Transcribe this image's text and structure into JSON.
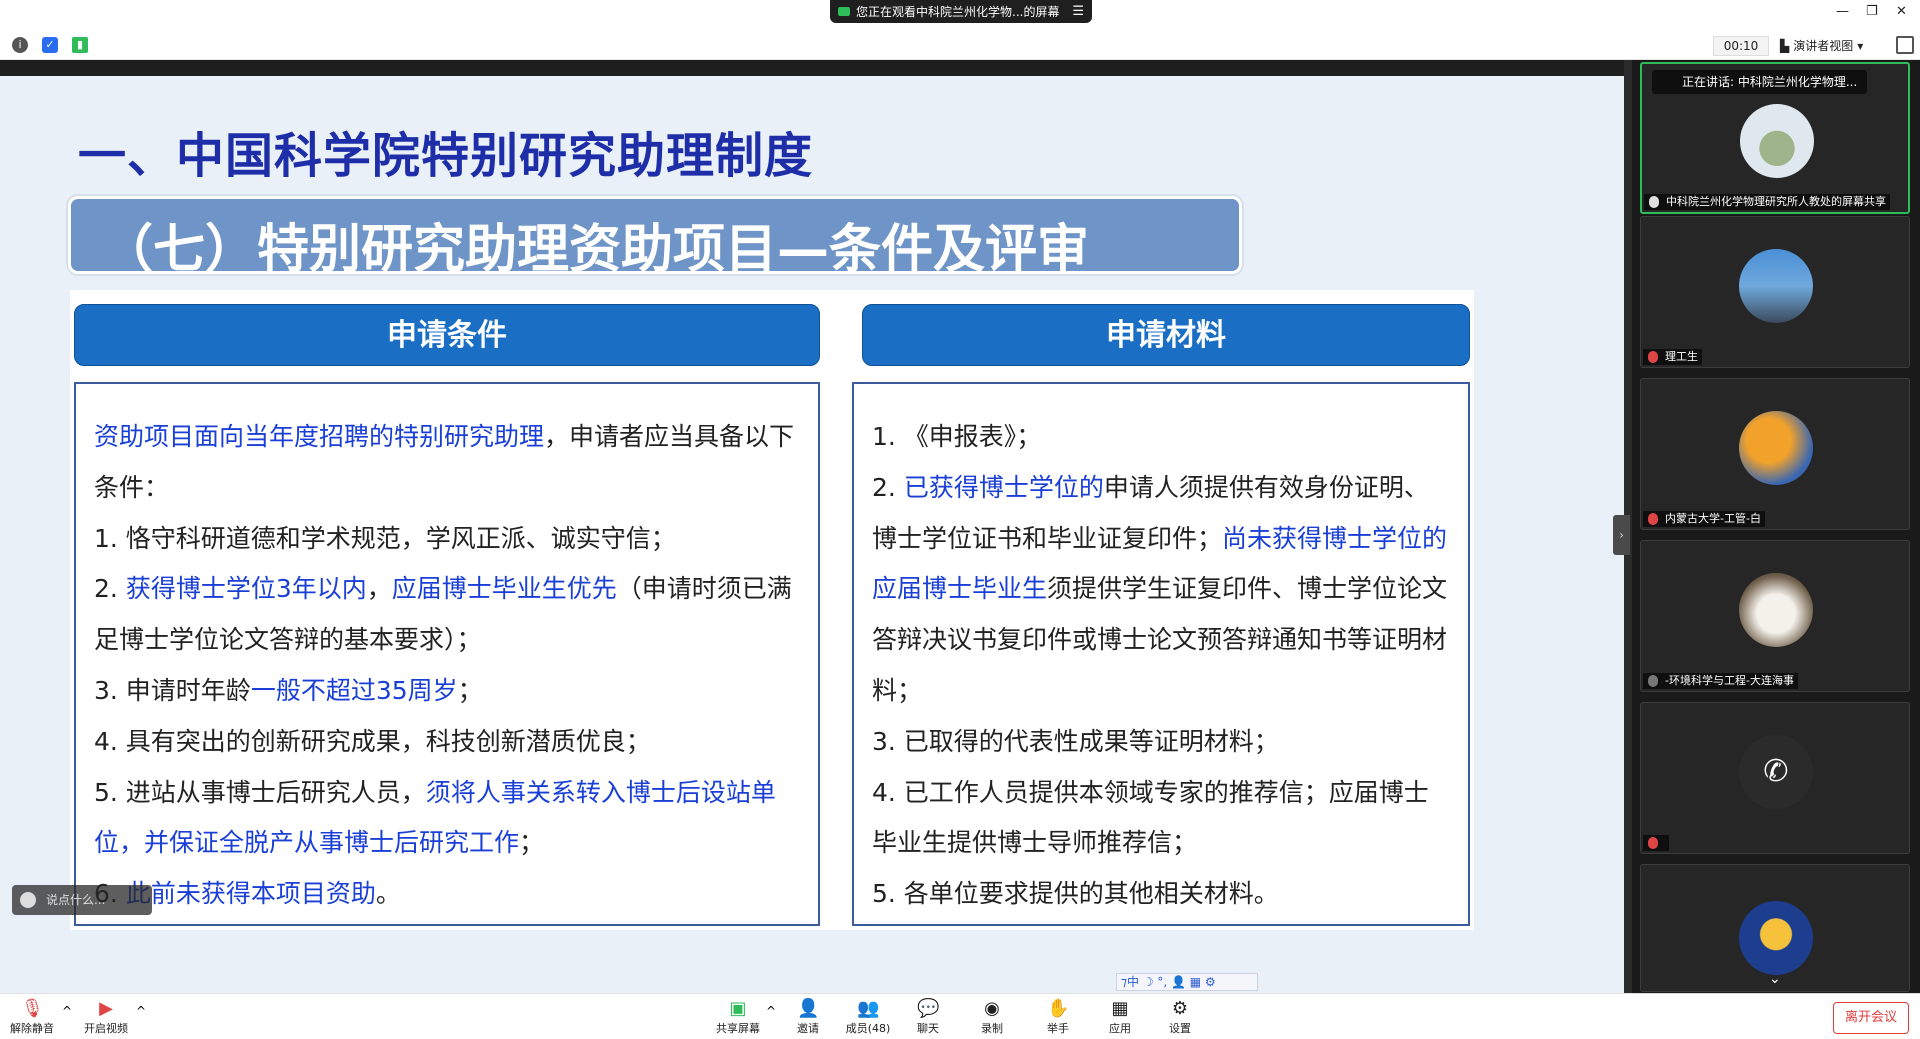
{
  "titlebar": {
    "share_banner": "您正在观看中科院兰州化学物...的屏幕",
    "min": "—",
    "restore": "❐",
    "close": "✕"
  },
  "toolbar": {
    "timer": "00:10",
    "view_label": "演讲者视图"
  },
  "slide": {
    "title": "一、中国科学院特别研究助理制度",
    "section": "（七）特别研究助理资助项目—条件及评审",
    "left_header": "申请条件",
    "right_header": "申请材料",
    "left": {
      "l1_blue": "资助项目面向当年度招聘的特别研究助理",
      "l1_rest": "，申请者应当具备以下条件：",
      "c1": "1. 恪守科研道德和学术规范，学风正派、诚实守信；",
      "c2_pre": "2. ",
      "c2_blue1": "获得博士学位3年以内",
      "c2_mid": "，",
      "c2_blue2": "应届博士毕业生优先",
      "c2_rest": "（申请时须已满足博士学位论文答辩的基本要求）；",
      "c3_pre": "3. 申请时年龄",
      "c3_blue": "一般不超过35周岁",
      "c3_rest": "；",
      "c4": "4. 具有突出的创新研究成果，科技创新潜质优良；",
      "c5_pre": "5. 进站从事博士后研究人员，",
      "c5_blue": "须将人事关系转入博士后设站单位，并保证全脱产从事博士后研究工作",
      "c5_rest": "；",
      "c6_pre": "6. ",
      "c6_blue": "此前未获得本项目资助",
      "c6_rest": "。"
    },
    "right": {
      "m1": "1. 《申报表》；",
      "m2_pre": "2.   ",
      "m2_blue1": "已获得博士学位的",
      "m2_mid": "申请人须提供有效身份证明、博士学位证书和毕业证复印件；",
      "m2_blue2": "尚未获得博士学位的应届博士毕业生",
      "m2_rest": "须提供学生证复印件、博士学位论文答辩决议书复印件或博士论文预答辩通知书等证明材料；",
      "m3": "3.   已取得的代表性成果等证明材料；",
      "m4": "4.   已工作人员提供本领域专家的推荐信；应届博士毕业生提供博士导师推荐信；",
      "m5": "5. 各单位要求提供的其他相关材料。"
    }
  },
  "chat_pill": "说点什么...",
  "ime_bar": "⁊中 ☽ °, 👤 ▦ ⚙",
  "participants": {
    "speaking": "正在讲话: 中科院兰州化学物理...",
    "tiles": [
      {
        "name": "中科院兰州化学物理研究所人教处的屏幕共享"
      },
      {
        "name": "理工生"
      },
      {
        "name": "内蒙古大学-工管-白"
      },
      {
        "name": "-环境科学与工程-大连海事"
      },
      {
        "name": ""
      },
      {
        "name": ""
      }
    ]
  },
  "bottom": {
    "unmute": "解除静音",
    "video": "开启视频",
    "share": "共享屏幕",
    "invite": "邀请",
    "members": "成员(48)",
    "chat": "聊天",
    "record": "录制",
    "raise": "举手",
    "apps": "应用",
    "settings": "设置",
    "leave": "离开会议"
  }
}
